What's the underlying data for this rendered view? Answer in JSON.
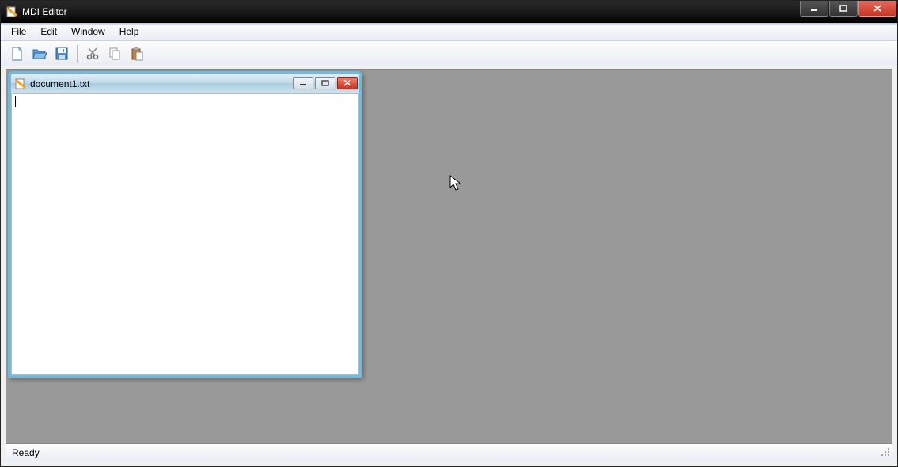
{
  "app": {
    "title": "MDI Editor"
  },
  "menu": {
    "file": "File",
    "edit": "Edit",
    "window": "Window",
    "help": "Help"
  },
  "toolbar": {
    "new": "new-file",
    "open": "open-file",
    "save": "save-file",
    "cut": "cut",
    "copy": "copy",
    "paste": "paste"
  },
  "child": {
    "title": "document1.txt",
    "content": ""
  },
  "status": {
    "text": "Ready"
  }
}
